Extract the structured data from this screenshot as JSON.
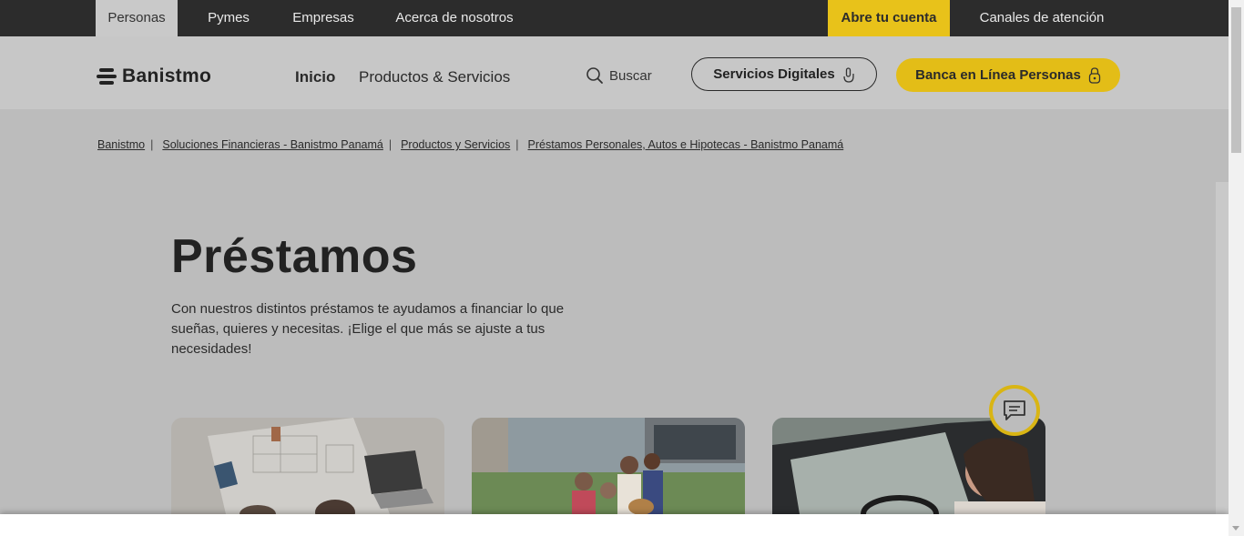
{
  "topbar": {
    "tabs": [
      "Personas",
      "Pymes",
      "Empresas",
      "Acerca de nosotros"
    ],
    "cta": "Abre tu cuenta",
    "channels": "Canales de atención"
  },
  "header": {
    "logo_text": "Banistmo",
    "nav": [
      "Inicio",
      "Productos & Servicios"
    ],
    "search_label": "Buscar",
    "digital_services": "Servicios Digitales",
    "online_banking": "Banca en Línea Personas"
  },
  "breadcrumb": [
    "Banistmo",
    "Soluciones Financieras - Banistmo Panamá",
    "Productos y Servicios",
    "Préstamos Personales, Autos e Hipotecas - Banistmo Panamá"
  ],
  "main": {
    "title": "Préstamos",
    "description": "Con nuestros distintos préstamos te ayudamos a financiar lo que sueñas, quieres y necesitas. ¡Elige el que más se ajuste a tus necesidades!"
  },
  "colors": {
    "brand_yellow": "#e3bd17",
    "topbar": "#2c2c2c"
  },
  "icons": [
    "search-icon",
    "touch-icon",
    "lock-icon",
    "chat-icon"
  ]
}
